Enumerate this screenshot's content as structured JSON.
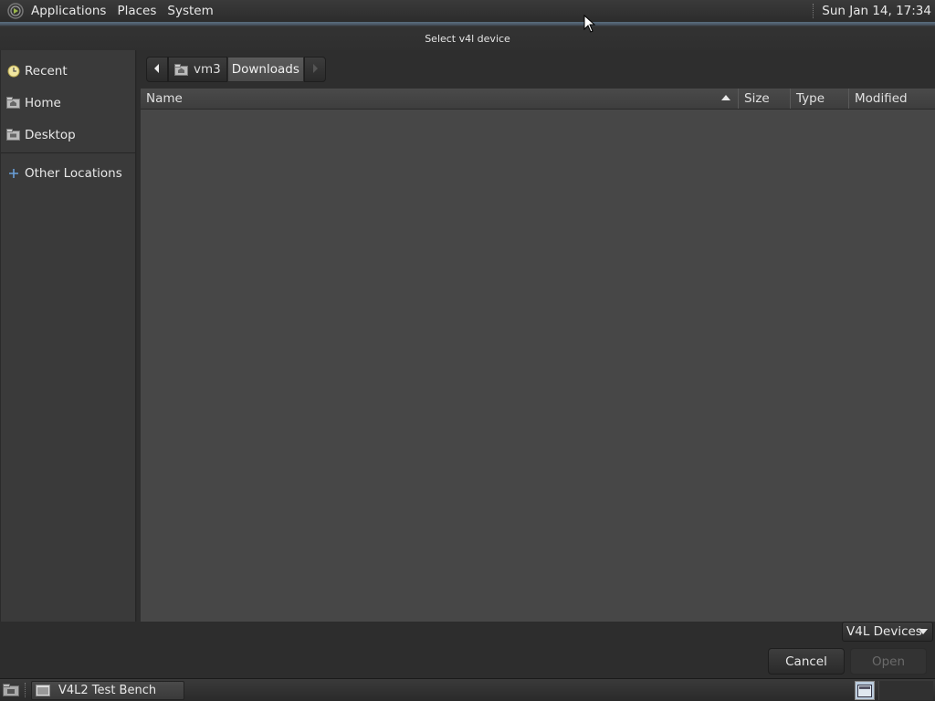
{
  "top_panel": {
    "menu": [
      "Applications",
      "Places",
      "System"
    ],
    "clock": "Sun Jan 14, 17:34"
  },
  "window": {
    "title": "Select v4l device"
  },
  "sidebar": {
    "items": [
      {
        "label": "Recent",
        "icon": "clock-icon"
      },
      {
        "label": "Home",
        "icon": "home-folder-icon"
      },
      {
        "label": "Desktop",
        "icon": "desktop-folder-icon"
      },
      {
        "label": "Other Locations",
        "icon": "plus-icon"
      }
    ]
  },
  "pathbar": {
    "home_label": "vm3",
    "current_label": "Downloads"
  },
  "file_list": {
    "columns": [
      "Name",
      "Size",
      "Type",
      "Modified"
    ],
    "sort_column": "Name",
    "rows": []
  },
  "filter": {
    "selected": "V4L Devices"
  },
  "buttons": {
    "cancel": "Cancel",
    "open": "Open"
  },
  "taskbar": {
    "window_label": "V4L2 Test Bench"
  }
}
